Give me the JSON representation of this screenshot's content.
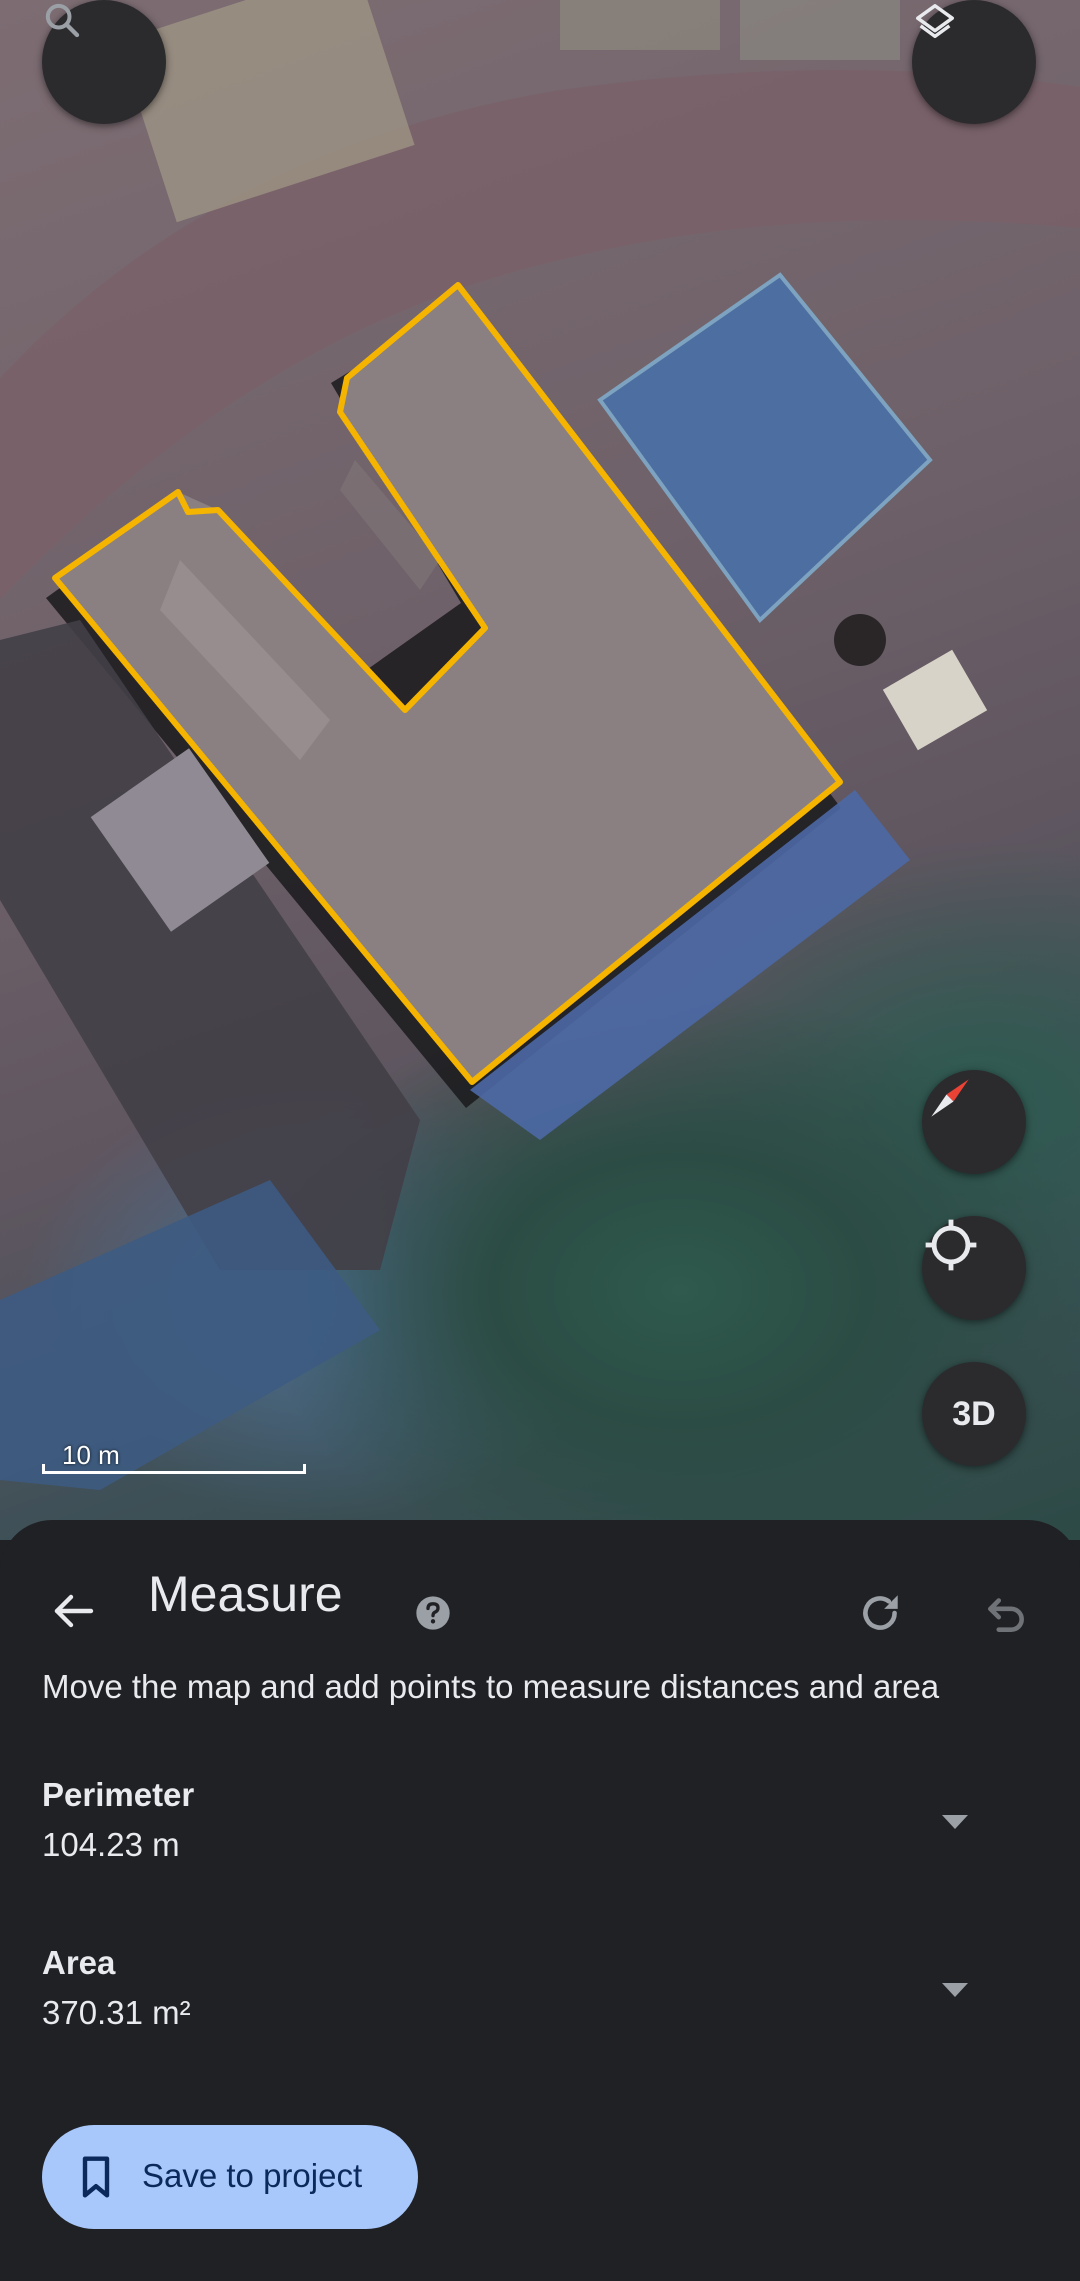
{
  "map": {
    "scale_label": "10 m",
    "overlay_color": "#f5b400"
  },
  "controls": {
    "search_icon": "search-icon",
    "layers_icon": "layers-icon",
    "compass_icon": "compass-icon",
    "locate_icon": "my-location-icon",
    "view_3d_label": "3D"
  },
  "panel": {
    "title": "Measure",
    "hint": "Move the map and add points to measure distances and area",
    "perimeter": {
      "label": "Perimeter",
      "value": "104.23 m"
    },
    "area": {
      "label": "Area",
      "value": "370.31 m²"
    },
    "save_label": "Save to project",
    "accent": "#a8c7fa"
  }
}
